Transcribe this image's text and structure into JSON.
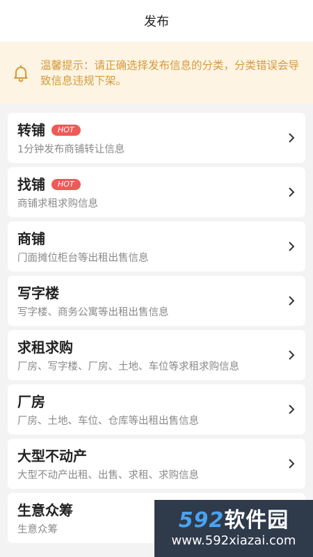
{
  "header": {
    "title": "发布"
  },
  "notice": {
    "text": "温馨提示：请正确选择发布信息的分类，分类错误会导致信息违规下架。"
  },
  "categories": [
    {
      "title": "转铺",
      "hot": "HOT",
      "sub": "1分钟发布商铺转让信息"
    },
    {
      "title": "找铺",
      "hot": "HOT",
      "sub": "商铺求租求购信息"
    },
    {
      "title": "商铺",
      "sub": "门面摊位柜台等出租出售信息"
    },
    {
      "title": "写字楼",
      "sub": "写字楼、商务公寓等出租出售信息"
    },
    {
      "title": "求租求购",
      "sub": "厂房、写字楼、厂房、土地、车位等求租求购信息"
    },
    {
      "title": "厂房",
      "sub": "厂房、土地、车位、仓库等出租出售信息"
    },
    {
      "title": "大型不动产",
      "sub": "大型不动产出租、出售、求租、求购信息"
    },
    {
      "title": "生意众筹",
      "sub": "生意众筹"
    }
  ],
  "watermark": {
    "brand_num": "592",
    "brand_text": "软件园",
    "url": "www.592xiazai.com"
  },
  "colors": {
    "hot": "#ee5a57",
    "notice_bg": "#fdf4e3",
    "notice_text": "#d69a3c"
  }
}
